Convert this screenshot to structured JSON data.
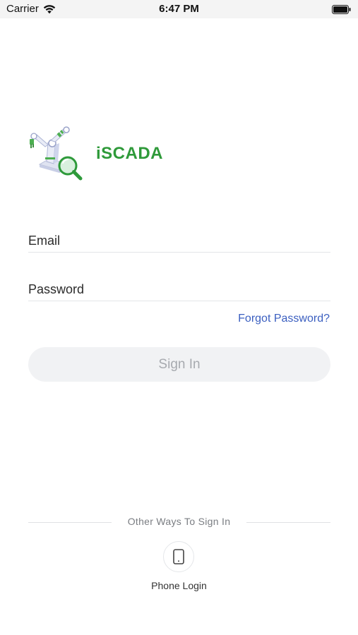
{
  "status_bar": {
    "carrier": "Carrier",
    "time": "6:47 PM",
    "wifi_icon": "wifi-icon",
    "battery_icon": "battery-icon"
  },
  "brand": {
    "app_name": "iSCADA",
    "logo_icon": "robot-arm-magnifier-logo",
    "accent_color": "#2f9a3a"
  },
  "login_form": {
    "email_placeholder": "Email",
    "email_value": "",
    "password_placeholder": "Password",
    "password_value": "",
    "forgot_password_label": "Forgot Password?",
    "sign_in_label": "Sign In",
    "link_color": "#3b5fc0"
  },
  "alt_signin": {
    "divider_label": "Other Ways To Sign In",
    "phone_login_label": "Phone Login",
    "phone_icon": "smartphone-icon"
  }
}
